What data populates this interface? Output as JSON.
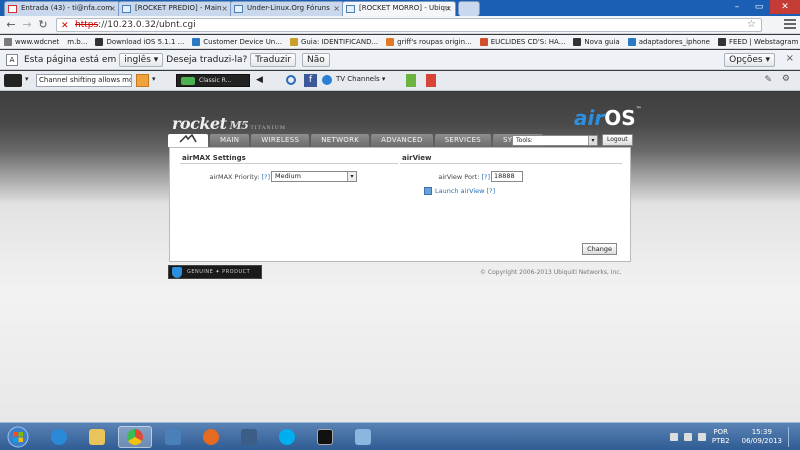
{
  "browser": {
    "tabs": [
      {
        "label": "Entrada (43) - ti@nfa.com",
        "icon": "gmail-icon",
        "active": false
      },
      {
        "label": "[ROCKET PREDIO] - Main",
        "icon": "ubnt-icon",
        "active": false
      },
      {
        "label": "Under-Linux.Org Fóruns",
        "icon": "ubnt-icon",
        "active": false
      },
      {
        "label": "[ROCKET MORRO] - Ubiqu",
        "icon": "ubnt-icon",
        "active": true
      }
    ],
    "address": {
      "scheme": "https",
      "rest": "://10.23.0.32/ubnt.cgi"
    },
    "bookmarks": [
      {
        "label": "www.wdcnet",
        "color": "#7a7a7a"
      },
      {
        "label": "m.b...",
        "color": "#7a7a7a"
      },
      {
        "label": "Download iOS 5.1.1 ...",
        "color": "#333333"
      },
      {
        "label": "Customer Device Un...",
        "color": "#2b79c2"
      },
      {
        "label": "Guia: IDENTIFICAND...",
        "color": "#c9a12a"
      },
      {
        "label": "griff's roupas origin...",
        "color": "#e07a2a"
      },
      {
        "label": "EUCLIDES CD'S: HA...",
        "color": "#d0512b"
      },
      {
        "label": "Nova guia",
        "color": "#333333"
      },
      {
        "label": "adaptadores_iphone",
        "color": "#2b79c2"
      },
      {
        "label": "FEED | Webstagram ...",
        "color": "#333333"
      }
    ],
    "translate": {
      "prefix": "Esta página está em",
      "language": "inglês",
      "question": "Deseja traduzi-la?",
      "translate_btn": "Traduzir",
      "no_btn": "Não",
      "options_btn": "Opções"
    },
    "extension": {
      "search_value": "Channel shifting allows mo",
      "radio_label": "Classic R...",
      "tv_channels": "TV Channels"
    }
  },
  "page": {
    "brand": {
      "rocket": "rocket",
      "model": "M5",
      "edition": "TITANIUM",
      "os_air": "air",
      "os_name": "OS",
      "tm": "™"
    },
    "nav": [
      "MAIN",
      "WIRELESS",
      "NETWORK",
      "ADVANCED",
      "SERVICES",
      "SYSTEM"
    ],
    "tools_label": "Tools:",
    "logout_label": "Logout",
    "airmax": {
      "title": "airMAX Settings",
      "priority_label": "airMAX Priority:",
      "help": "[?]",
      "priority_value": "Medium"
    },
    "airview": {
      "title": "airView",
      "port_label": "airView Port:",
      "help": "[?]",
      "port_value": "18888",
      "launch_label": "Launch airView",
      "launch_help": "[?]"
    },
    "change_label": "Change",
    "genuine": "GENUINE ✦ PRODUCT",
    "copyright": "© Copyright 2006-2013 Ubiquiti Networks, Inc."
  },
  "taskbar": {
    "apps": [
      {
        "name": "ie-icon",
        "color": "#2a8ad8"
      },
      {
        "name": "folder-icon",
        "color": "#e8c45a"
      },
      {
        "name": "chrome-icon",
        "color": "#dd4b39",
        "active": true
      },
      {
        "name": "network-icon",
        "color": "#4a7fb9"
      },
      {
        "name": "firefox-icon",
        "color": "#e66a1f"
      },
      {
        "name": "window-icon",
        "color": "#3b5d86"
      },
      {
        "name": "skype-icon",
        "color": "#00aff0"
      },
      {
        "name": "cmd-icon",
        "color": "#111111"
      },
      {
        "name": "app-icon",
        "color": "#8ab6e0"
      }
    ],
    "lang_top": "POR",
    "lang_bottom": "PTB2",
    "time": "15:39",
    "date": "06/09/2013"
  }
}
